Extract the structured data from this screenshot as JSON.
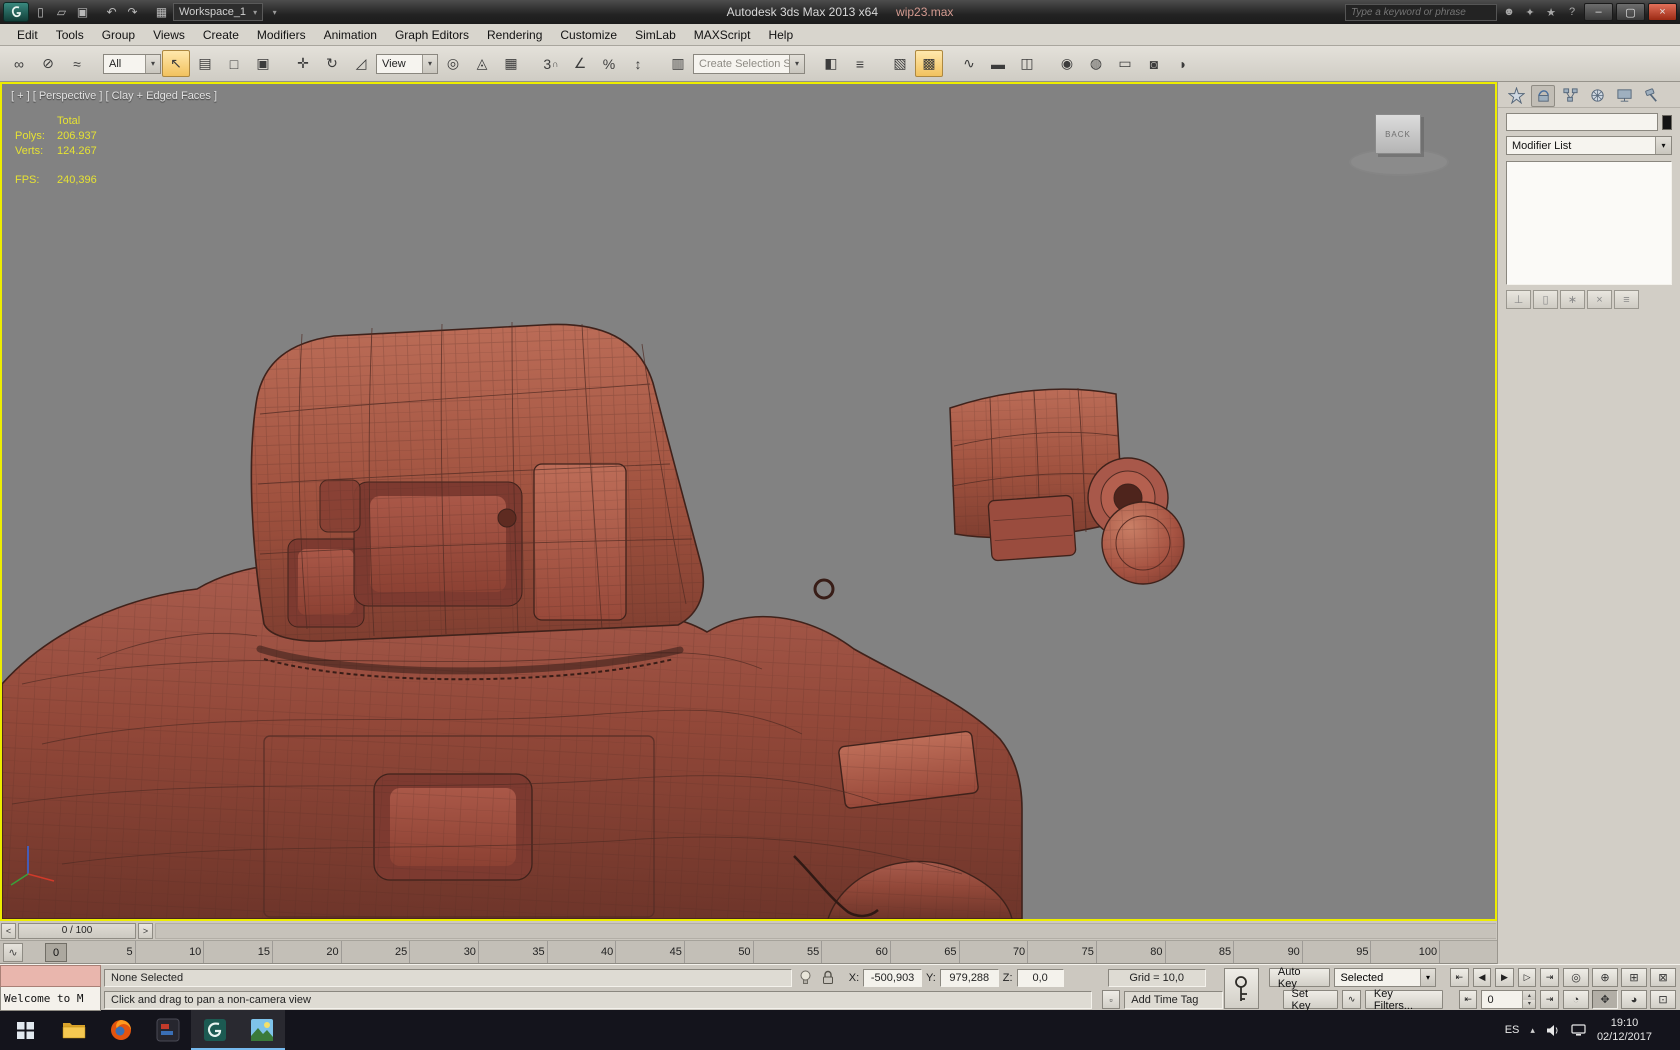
{
  "titlebar": {
    "workspace": "Workspace_1",
    "app_title": "Autodesk 3ds Max 2013 x64",
    "file_name": "wip23.max",
    "search_placeholder": "Type a keyword or phrase"
  },
  "menu": {
    "items": [
      "Edit",
      "Tools",
      "Group",
      "Views",
      "Create",
      "Modifiers",
      "Animation",
      "Graph Editors",
      "Rendering",
      "Customize",
      "SimLab",
      "MAXScript",
      "Help"
    ]
  },
  "toolbar": {
    "filter_all": "All",
    "view_label": "View",
    "selection_set_placeholder": "Create Selection Se",
    "snap_level": "3"
  },
  "viewport": {
    "header_label": "[ + ] [ Perspective ] [ Clay + Edged Faces ]",
    "stats": {
      "total_label": "Total",
      "polys_label": "Polys:",
      "polys_value": "206.937",
      "verts_label": "Verts:",
      "verts_value": "124.267",
      "fps_label": "FPS:",
      "fps_value": "240,396"
    },
    "viewcube_face": "BACK",
    "clay_color": "#a25446",
    "background_color": "#828282"
  },
  "command_panel": {
    "modifier_list_label": "Modifier List"
  },
  "trackbar": {
    "prev": "<",
    "range_label": "0 / 100",
    "next": ">"
  },
  "timeline": {
    "current_frame": "0",
    "ticks": [
      "5",
      "10",
      "15",
      "20",
      "25",
      "30",
      "35",
      "40",
      "45",
      "50",
      "55",
      "60",
      "65",
      "70",
      "75",
      "80",
      "85",
      "90",
      "95",
      "100"
    ]
  },
  "statusbar": {
    "selection_status": "None Selected",
    "prompt": "Click and drag to pan a non-camera view",
    "x_label": "X:",
    "x_value": "-500,903",
    "y_label": "Y:",
    "y_value": "979,288",
    "z_label": "Z:",
    "z_value": "0,0",
    "grid_label": "Grid = 10,0",
    "add_time_tag": "Add Time Tag",
    "auto_key_label": "Auto Key",
    "set_key_label": "Set Key",
    "key_mode_label": "Selected",
    "key_filters_label": "Key Filters...",
    "frame_field": "0"
  },
  "welcome_window": {
    "title_text": "Welcome to M"
  },
  "taskbar": {
    "language": "ES",
    "clock_time": "19:10",
    "clock_date": "02/12/2017"
  },
  "glyphs": {
    "dd_arrow": "▾",
    "qat_new": "▯",
    "qat_open": "▱",
    "qat_save": "▣",
    "qat_undo": "↶",
    "qat_redo": "↷",
    "qat_project": "▦",
    "tb_account": "☻",
    "tb_key": "✦",
    "tb_star": "★",
    "tb_help": "?",
    "win_min": "–",
    "win_max": "▢",
    "win_close": "×",
    "link": "∞",
    "unlink": "⊘",
    "bind": "≈",
    "select": "↖",
    "select_by_name": "▤",
    "marquee": "□",
    "window_crossing": "▣",
    "move": "✛",
    "rotate": "↻",
    "scale": "◿",
    "pivot": "◎",
    "manipulate": "◬",
    "kbd_override": "▦",
    "snap_magnet": "∩",
    "angle_snap": "∠",
    "percent_snap": "%",
    "spinner_snap": "↕",
    "named_sets": "▥",
    "mirror": "◧",
    "align": "≡",
    "layers": "▧",
    "graphite": "▩",
    "curve_editor": "∿",
    "dope_sheet": "▬",
    "schematic": "◫",
    "material": "◉",
    "render_setup": "◍",
    "rendered_frame": "▭",
    "render_prod": "◙",
    "render_iter": "◗",
    "mini_curve": "∿",
    "goto_start": "⇤",
    "prev_frame": "◀",
    "play": "▶",
    "next_frame": "▷",
    "goto_end": "⇥",
    "zoom": "◎",
    "zoom_all": "⊕",
    "zoom_ext": "⊞",
    "zoom_ext_all": "⊠",
    "fov": "◔",
    "pan": "✥",
    "orbit": "◕",
    "maximize_vp": "⊡",
    "spin_up": "▴",
    "spin_down": "▾",
    "pin_stack": "⊥",
    "show_end": "▯",
    "make_unique": "∗",
    "remove_mod": "×",
    "config_sets": "≡",
    "time_tag": "▫",
    "tray_chevron": "▴"
  }
}
